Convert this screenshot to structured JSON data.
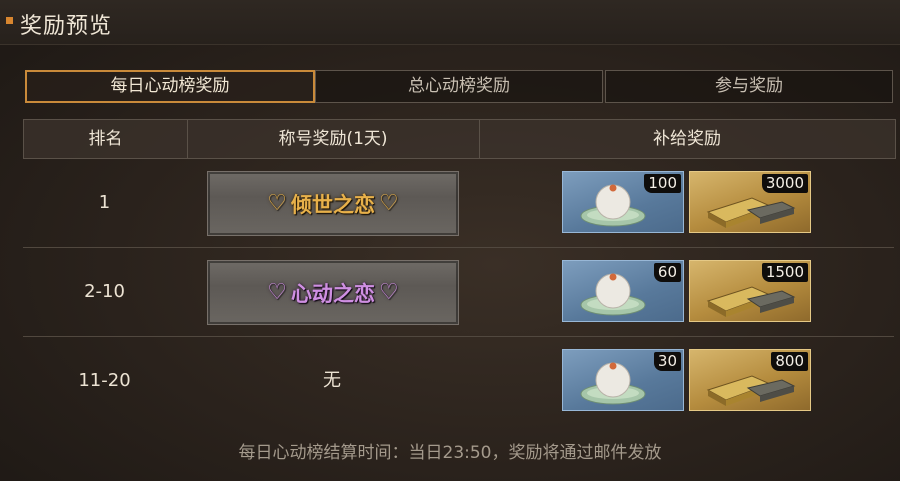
{
  "header": {
    "title": "奖励预览"
  },
  "tabs": [
    {
      "label": "每日心动榜奖励",
      "active": true
    },
    {
      "label": "总心动榜奖励",
      "active": false
    },
    {
      "label": "参与奖励",
      "active": false
    }
  ],
  "table": {
    "columns": [
      "排名",
      "称号奖励(1天)",
      "补给奖励"
    ],
    "rows": [
      {
        "rank": "1",
        "title": "倾世之恋",
        "title_color": "gold",
        "items": [
          {
            "icon": "rice-bun-on-leaf",
            "qty": "100"
          },
          {
            "icon": "gold-bars",
            "qty": "3000"
          }
        ]
      },
      {
        "rank": "2-10",
        "title": "心动之恋",
        "title_color": "purple",
        "items": [
          {
            "icon": "rice-bun-on-leaf",
            "qty": "60"
          },
          {
            "icon": "gold-bars",
            "qty": "1500"
          }
        ]
      },
      {
        "rank": "11-20",
        "title": "无",
        "title_color": "none",
        "items": [
          {
            "icon": "rice-bun-on-leaf",
            "qty": "30"
          },
          {
            "icon": "gold-bars",
            "qty": "800"
          }
        ]
      }
    ]
  },
  "footer": {
    "note": "每日心动榜结算时间：当日23:50，奖励将通过邮件发放"
  },
  "colors": {
    "accent": "#c98a3a",
    "title_gold": "#e8b14a",
    "title_purple": "#cf8fe2",
    "item_blue": "#6b8cae",
    "item_gold": "#b58c3e"
  }
}
